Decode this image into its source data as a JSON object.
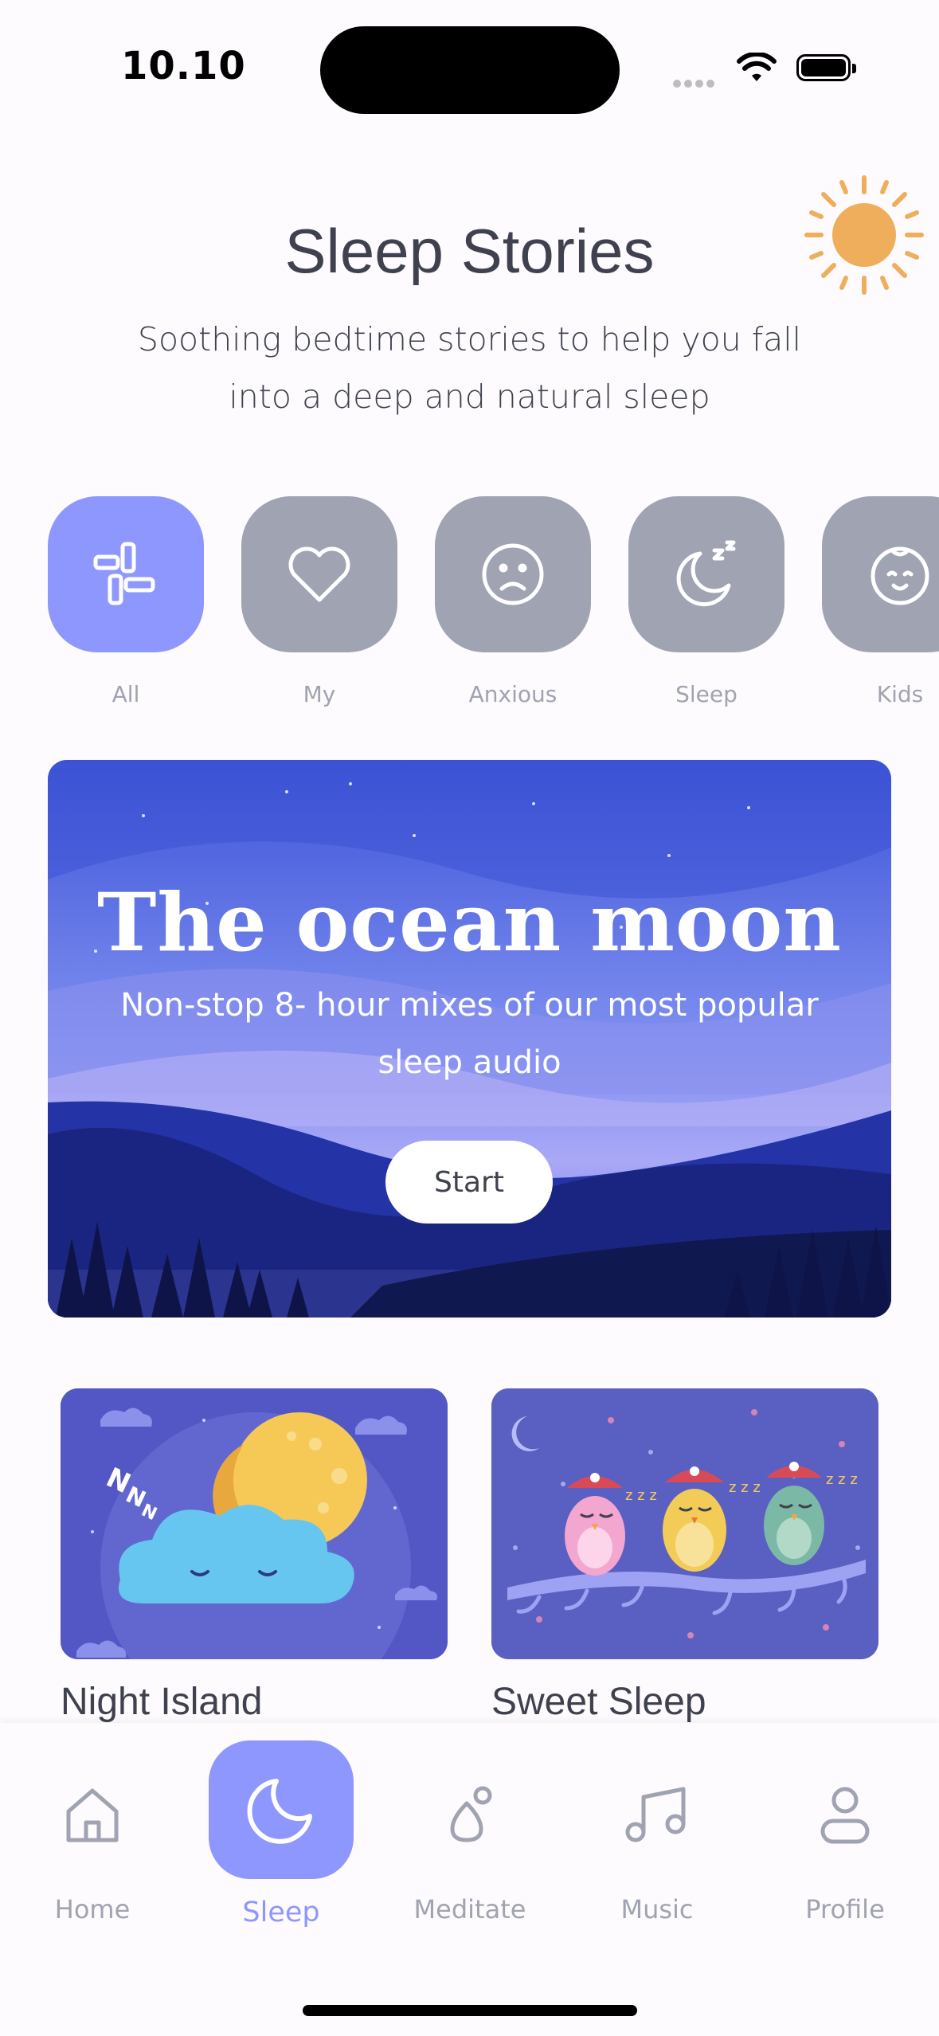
{
  "status": {
    "time": "10.10"
  },
  "header": {
    "title": "Sleep Stories",
    "subtitle": "Soothing bedtime stories to help you fall into a deep and natural sleep"
  },
  "categories": [
    {
      "label": "All",
      "icon": "grid-icon",
      "active": true
    },
    {
      "label": "My",
      "icon": "heart-icon",
      "active": false
    },
    {
      "label": "Anxious",
      "icon": "sad-face-icon",
      "active": false
    },
    {
      "label": "Sleep",
      "icon": "moon-zzz-icon",
      "active": false
    },
    {
      "label": "Kids",
      "icon": "baby-face-icon",
      "active": false
    }
  ],
  "hero": {
    "title": "The ocean moon",
    "subtitle": "Non-stop 8- hour mixes of our most popular sleep audio",
    "button_label": "Start"
  },
  "stories": [
    {
      "title": "Night Island",
      "art": "cloud-moon-illustration"
    },
    {
      "title": "Sweet Sleep",
      "art": "sleeping-owls-illustration"
    }
  ],
  "tabs": [
    {
      "label": "Home",
      "icon": "home-icon",
      "active": false
    },
    {
      "label": "Sleep",
      "icon": "moon-icon",
      "active": true
    },
    {
      "label": "Meditate",
      "icon": "meditate-icon",
      "active": false
    },
    {
      "label": "Music",
      "icon": "music-note-icon",
      "active": false
    },
    {
      "label": "Profile",
      "icon": "profile-icon",
      "active": false
    }
  ],
  "colors": {
    "accent": "#8E97FD",
    "inactive": "#A0A3B1",
    "text": "#3F414E",
    "background": "#FDFBFD"
  }
}
